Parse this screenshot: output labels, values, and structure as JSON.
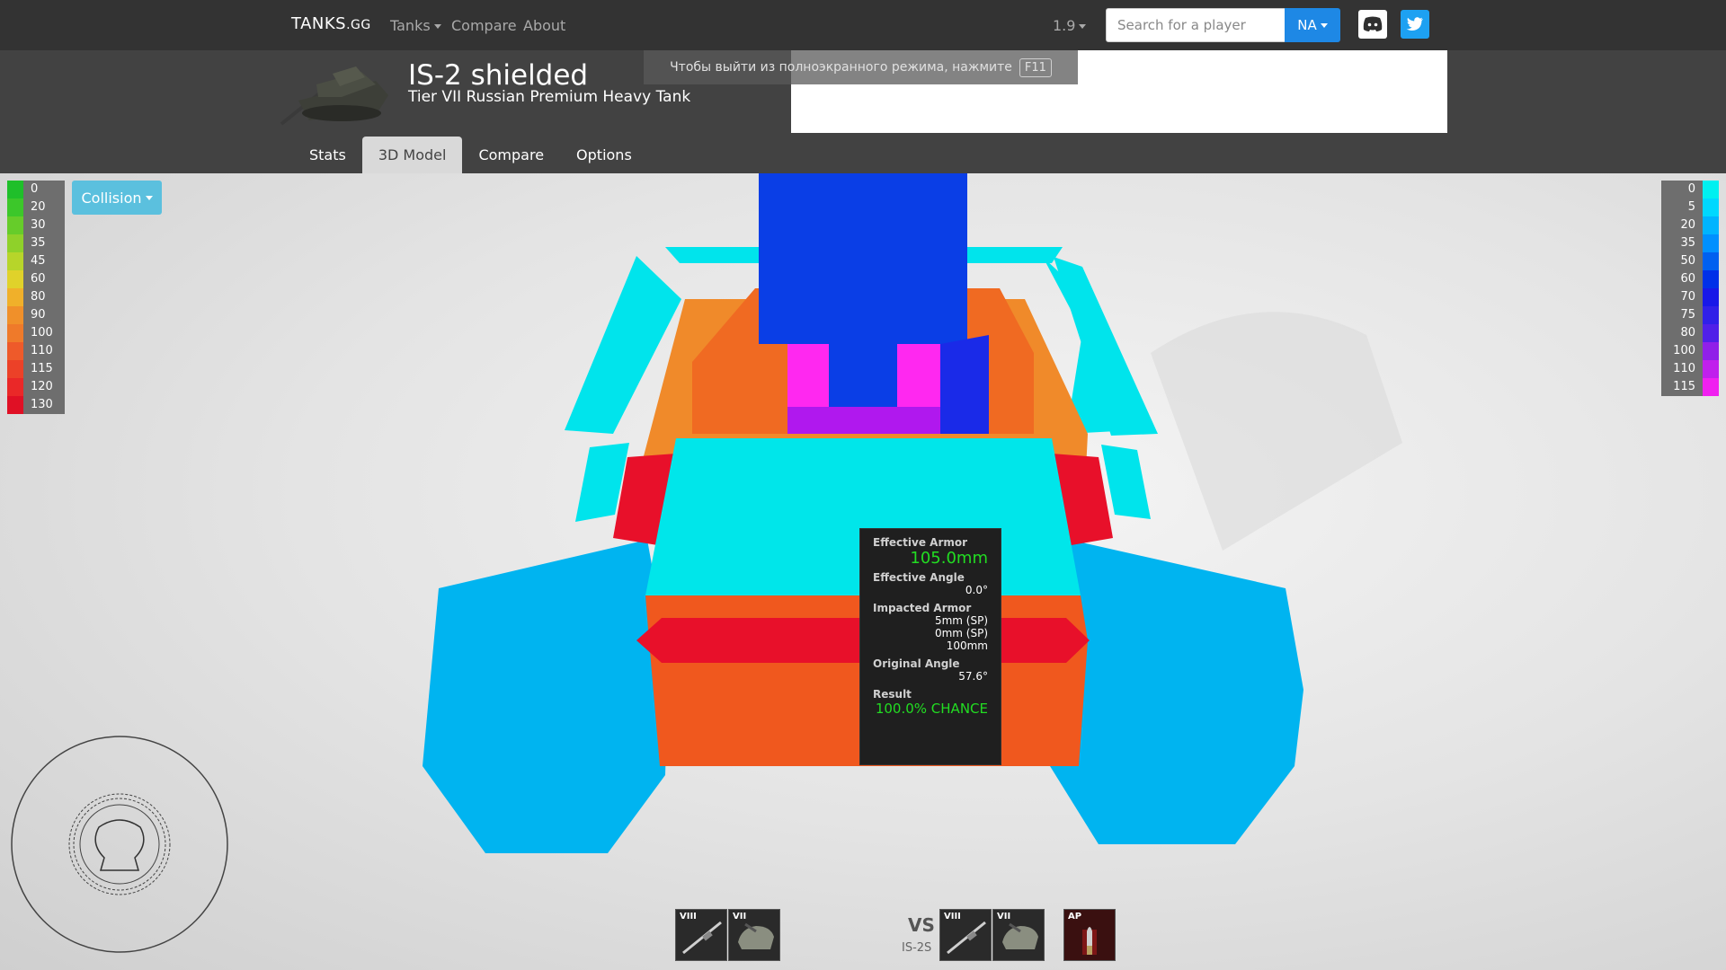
{
  "navbar": {
    "brand_main": "TANKS",
    "brand_suffix": ".GG",
    "links": {
      "tanks": "Tanks",
      "compare": "Compare",
      "about": "About"
    },
    "version": "1.9",
    "search_placeholder": "Search for a player",
    "region": "NA"
  },
  "tank": {
    "name": "IS-2 shielded",
    "subtitle": "Tier VII Russian Premium Heavy Tank"
  },
  "fullscreen_hint": {
    "text": "Чтобы выйти из полноэкранного режима, нажмите",
    "key": "F11"
  },
  "tabs": [
    {
      "label": "Stats",
      "active": false
    },
    {
      "label": "3D Model",
      "active": true
    },
    {
      "label": "Compare",
      "active": false
    },
    {
      "label": "Options",
      "active": false
    }
  ],
  "viewer": {
    "mode_button": "Collision",
    "left_legend": [
      {
        "value": "0",
        "color": "#1fbf2a"
      },
      {
        "value": "20",
        "color": "#3cc72a"
      },
      {
        "value": "30",
        "color": "#66cc2a"
      },
      {
        "value": "35",
        "color": "#8fd12a"
      },
      {
        "value": "45",
        "color": "#b7d52a"
      },
      {
        "value": "60",
        "color": "#e0d22a"
      },
      {
        "value": "80",
        "color": "#f0b02a"
      },
      {
        "value": "90",
        "color": "#f0902a"
      },
      {
        "value": "100",
        "color": "#ef7a2a"
      },
      {
        "value": "110",
        "color": "#ee5a2a"
      },
      {
        "value": "115",
        "color": "#ec4128"
      },
      {
        "value": "120",
        "color": "#ea2828"
      },
      {
        "value": "130",
        "color": "#e01025"
      }
    ],
    "right_legend": [
      {
        "value": "0",
        "color": "#00f0f0"
      },
      {
        "value": "5",
        "color": "#00d8ff"
      },
      {
        "value": "20",
        "color": "#00b4ff"
      },
      {
        "value": "35",
        "color": "#0090ff"
      },
      {
        "value": "50",
        "color": "#0060f0"
      },
      {
        "value": "60",
        "color": "#0030e8"
      },
      {
        "value": "70",
        "color": "#1818e8"
      },
      {
        "value": "75",
        "color": "#3020e8"
      },
      {
        "value": "80",
        "color": "#5020e8"
      },
      {
        "value": "100",
        "color": "#9020e8"
      },
      {
        "value": "110",
        "color": "#c020ec"
      },
      {
        "value": "115",
        "color": "#f020f0"
      }
    ]
  },
  "tooltip": {
    "effective_armor_label": "Effective Armor",
    "effective_armor_value": "105.0mm",
    "effective_angle_label": "Effective Angle",
    "effective_angle_value": "0.0°",
    "impacted_armor_label": "Impacted Armor",
    "impacted_armor_values": [
      "5mm (SP)",
      "0mm (SP)",
      "100mm"
    ],
    "original_angle_label": "Original Angle",
    "original_angle_value": "57.6°",
    "result_label": "Result",
    "result_value": "100.0% CHANCE"
  },
  "bottom": {
    "attacker_slots": [
      {
        "tier": "VIII"
      },
      {
        "tier": "VII"
      }
    ],
    "vs_label": "VS",
    "target_name": "IS-2S",
    "target_slots": [
      {
        "tier": "VIII"
      },
      {
        "tier": "VII"
      }
    ],
    "ammo_slot": {
      "tier": "AP"
    }
  }
}
